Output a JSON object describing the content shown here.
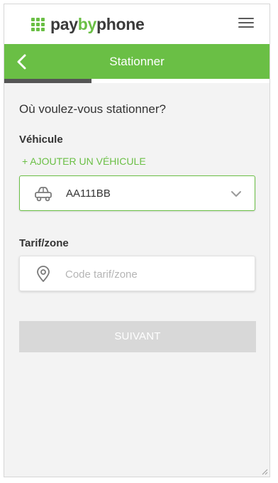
{
  "brand": {
    "name_part1": "pay",
    "name_part2": "by",
    "name_part3": "phone",
    "accent": "#6abf45"
  },
  "header": {
    "title": "Stationner",
    "back_icon": "chevron-left-icon",
    "menu_icon": "hamburger-menu-icon"
  },
  "progress": {
    "fraction": 0.33
  },
  "form": {
    "question": "Où voulez-vous stationner?",
    "vehicle_label": "Véhicule",
    "add_vehicle_link": "+ AJOUTER UN VÉHICULE",
    "vehicle_icon": "car-icon",
    "vehicle_value": "AA111BB",
    "zone_label": "Tarif/zone",
    "zone_icon": "location-pin-icon",
    "zone_placeholder": "Code tarif/zone",
    "zone_value": ""
  },
  "actions": {
    "next_label": "SUIVANT"
  }
}
